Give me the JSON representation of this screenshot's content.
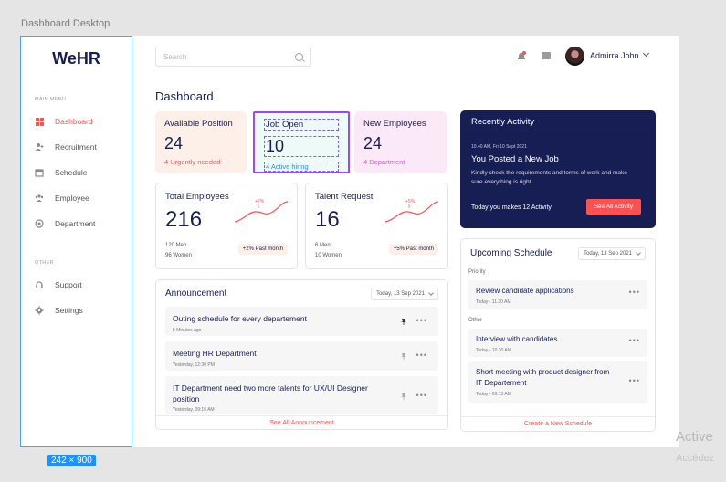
{
  "frame_label": "Dashboard Desktop",
  "frame_size": "242 × 900",
  "sidebar": {
    "logo": "WeHR",
    "main_caption": "MAIN MENU",
    "main_items": [
      {
        "label": "Dashboard",
        "icon": "grid-icon"
      },
      {
        "label": "Recruitment",
        "icon": "user-plus-icon"
      },
      {
        "label": "Schedule",
        "icon": "calendar-icon"
      },
      {
        "label": "Employee",
        "icon": "users-icon"
      },
      {
        "label": "Department",
        "icon": "globe-icon"
      }
    ],
    "other_caption": "OTHER",
    "other_items": [
      {
        "label": "Support",
        "icon": "headset-icon"
      },
      {
        "label": "Settings",
        "icon": "gear-icon"
      }
    ]
  },
  "header": {
    "search_placeholder": "Search",
    "user_name": "Admirra John"
  },
  "page_title": "Dashboard",
  "stats": [
    {
      "title": "Available Position",
      "value": "24",
      "sub": "4 Urgently needed"
    },
    {
      "title": "Job Open",
      "value": "10",
      "sub": "4 Active hiring"
    },
    {
      "title": "New Employees",
      "value": "24",
      "sub": "4 Department"
    }
  ],
  "metrics": [
    {
      "title": "Total Employees",
      "value": "216",
      "line1": "120 Men",
      "line2": "96 Women",
      "badge": "+2% Past month",
      "spark_label": "+2%"
    },
    {
      "title": "Talent Request",
      "value": "16",
      "line1": "6 Men",
      "line2": "10 Women",
      "badge": "+5% Past month",
      "spark_label": "+5%"
    }
  ],
  "announcement": {
    "title": "Announcement",
    "date": "Today, 13 Sep 2021",
    "items": [
      {
        "text": "Outing schedule for every departement",
        "time": "5 Minutes ago"
      },
      {
        "text": "Meeting HR Department",
        "time": "Yesterday, 12:30 PM"
      },
      {
        "text": "IT Department need two more talents for UX/UI Designer position",
        "time": "Yesterday, 09:15 AM"
      }
    ],
    "see_all": "See All Announcement"
  },
  "activity": {
    "title": "Recently Activity",
    "time": "10.40 AM, Fri 10 Sept 2021",
    "headline": "You Posted a New Job",
    "desc": "Kindly check the requirements and terms of work and make sure everything is right.",
    "count_text": "Today you makes 12 Activity",
    "button": "See All Activity"
  },
  "schedule": {
    "title": "Upcoming Schedule",
    "date": "Today, 13 Sep 2021",
    "priority_caption": "Priority",
    "other_caption": "Other",
    "items": [
      {
        "text": "Review candidate applications",
        "time": "Today - 11.30 AM"
      },
      {
        "text": "Interview with candidates",
        "time": "Today - 10.30 AM"
      },
      {
        "text": "Short meeting with product designer from IT Departement",
        "time": "Today - 09.15 AM"
      }
    ],
    "footer": "Create a New Schedule"
  },
  "watermark": {
    "line1": "Active",
    "line2": "Accédez"
  },
  "colors": {
    "accent": "#ff5151",
    "navy": "#161e54",
    "selection": "#9747ff"
  }
}
